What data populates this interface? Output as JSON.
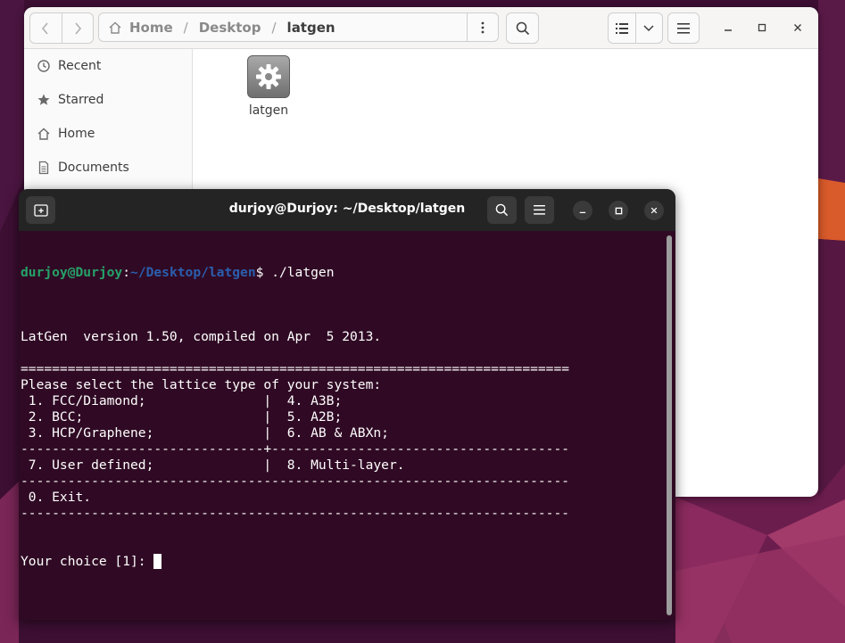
{
  "file_manager": {
    "breadcrumbs": [
      "Home",
      "Desktop",
      "latgen"
    ],
    "sidebar": [
      {
        "label": "Recent",
        "icon": "clock-icon"
      },
      {
        "label": "Starred",
        "icon": "star-icon"
      },
      {
        "label": "Home",
        "icon": "home-icon"
      },
      {
        "label": "Documents",
        "icon": "document-icon"
      }
    ],
    "files": [
      {
        "name": "latgen",
        "icon": "gear-icon"
      }
    ]
  },
  "terminal": {
    "title": "durjoy@Durjoy: ~/Desktop/latgen",
    "prompt_user": "durjoy@Durjoy",
    "prompt_colon": ":",
    "prompt_path": "~/Desktop/latgen",
    "prompt_symbol": "$ ",
    "command": "./latgen",
    "output": [
      "",
      "LatGen  version 1.50, compiled on Apr  5 2013.",
      "",
      "======================================================================",
      "Please select the lattice type of your system:",
      " 1. FCC/Diamond;               |  4. A3B;",
      " 2. BCC;                       |  5. A2B;",
      " 3. HCP/Graphene;              |  6. AB & ABXn;",
      "-------------------------------+--------------------------------------",
      " 7. User defined;              |  8. Multi-layer.",
      "----------------------------------------------------------------------",
      " 0. Exit.",
      "----------------------------------------------------------------------"
    ],
    "input_prompt": "Your choice [1]: "
  },
  "colors": {
    "terminal_bg": "#300a24",
    "prompt_user": "#26a269",
    "prompt_path": "#2a5eae",
    "header_dark": "#242424"
  }
}
